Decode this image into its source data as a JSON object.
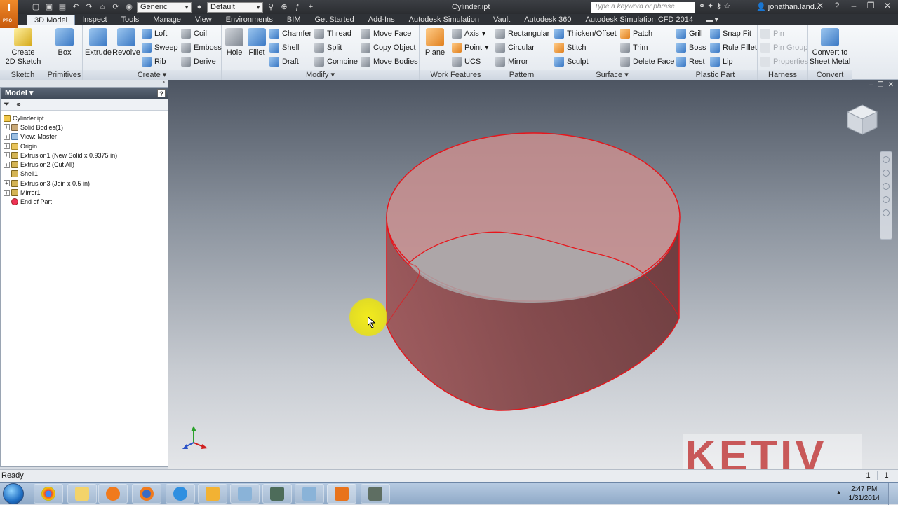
{
  "titlebar": {
    "doc_title": "Cylinder.ipt",
    "appearance_combo": "Generic",
    "style_combo": "Default",
    "search_placeholder": "Type a keyword or phrase",
    "user": "jonathan.land..."
  },
  "tabs": [
    "3D Model",
    "Inspect",
    "Tools",
    "Manage",
    "View",
    "Environments",
    "BIM",
    "Get Started",
    "Add-Ins",
    "Autodesk Simulation",
    "Vault",
    "Autodesk 360",
    "Autodesk Simulation CFD 2014"
  ],
  "active_tab": "3D Model",
  "ribbon": {
    "sketch": {
      "title": "Sketch",
      "create_2d_sketch": "Create\n2D Sketch"
    },
    "primitives": {
      "title": "Primitives",
      "box": "Box"
    },
    "create": {
      "title": "Create",
      "extrude": "Extrude",
      "revolve": "Revolve",
      "loft": "Loft",
      "sweep": "Sweep",
      "rib": "Rib",
      "coil": "Coil",
      "emboss": "Emboss",
      "derive": "Derive"
    },
    "modify": {
      "title": "Modify",
      "hole": "Hole",
      "fillet": "Fillet",
      "chamfer": "Chamfer",
      "shell": "Shell",
      "draft": "Draft",
      "thread": "Thread",
      "split": "Split",
      "combine": "Combine",
      "move_face": "Move Face",
      "copy_object": "Copy Object",
      "move_bodies": "Move Bodies"
    },
    "work_features": {
      "title": "Work Features",
      "plane": "Plane",
      "axis": "Axis",
      "point": "Point",
      "ucs": "UCS"
    },
    "pattern": {
      "title": "Pattern",
      "rectangular": "Rectangular",
      "circular": "Circular",
      "mirror": "Mirror"
    },
    "surface": {
      "title": "Surface",
      "thicken_offset": "Thicken/Offset",
      "stitch": "Stitch",
      "sculpt": "Sculpt",
      "patch": "Patch",
      "trim": "Trim",
      "delete_face": "Delete Face"
    },
    "plastic_part": {
      "title": "Plastic Part",
      "grill": "Grill",
      "boss": "Boss",
      "rest": "Rest",
      "snap_fit": "Snap Fit",
      "rule_fillet": "Rule Fillet",
      "lip": "Lip"
    },
    "harness": {
      "title": "Harness",
      "pin": "Pin",
      "pin_group": "Pin Group",
      "properties": "Properties"
    },
    "convert": {
      "title": "Convert",
      "convert_to_sheet_metal": "Convert to\nSheet Metal"
    }
  },
  "browser": {
    "title": "Model",
    "help": "?",
    "tree": [
      {
        "label": "Cylinder.ipt",
        "icon": "part-icon",
        "expander": ""
      },
      {
        "label": "Solid Bodies(1)",
        "icon": "solid-bodies-icon",
        "expander": "+"
      },
      {
        "label": "View: Master",
        "icon": "view-icon",
        "expander": "+"
      },
      {
        "label": "Origin",
        "icon": "folder-icon",
        "expander": "+"
      },
      {
        "label": "Extrusion1 (New Solid x 0.9375 in)",
        "icon": "extrusion-icon",
        "expander": "+"
      },
      {
        "label": "Extrusion2 (Cut All)",
        "icon": "extrusion-icon",
        "expander": "+"
      },
      {
        "label": "Shell1",
        "icon": "shell-icon",
        "expander": ""
      },
      {
        "label": "Extrusion3 (Join x 0.5 in)",
        "icon": "extrusion-icon",
        "expander": "+"
      },
      {
        "label": "Mirror1",
        "icon": "mirror-icon",
        "expander": "+"
      },
      {
        "label": "End of Part",
        "icon": "end-of-part-icon",
        "expander": ""
      }
    ]
  },
  "viewport": {
    "watermark": "KETIV",
    "shape_fill": "#a85a5a",
    "shape_edge": "#e8151b"
  },
  "statusbar": {
    "text": "Ready",
    "count1": "1",
    "count2": "1"
  },
  "taskbar": {
    "apps": [
      "chrome-icon",
      "explorer-icon",
      "media-player-icon",
      "firefox-icon",
      "ie-icon",
      "outlook-icon",
      "app-icon",
      "app-icon",
      "app-icon",
      "inventor-icon",
      "app-icon"
    ],
    "time": "2:47 PM",
    "date": "1/31/2014"
  },
  "colors": {
    "accent": "#e8151b",
    "ribbon_bg": "#eef1f5",
    "titlebar_bg": "#2b2d31"
  }
}
